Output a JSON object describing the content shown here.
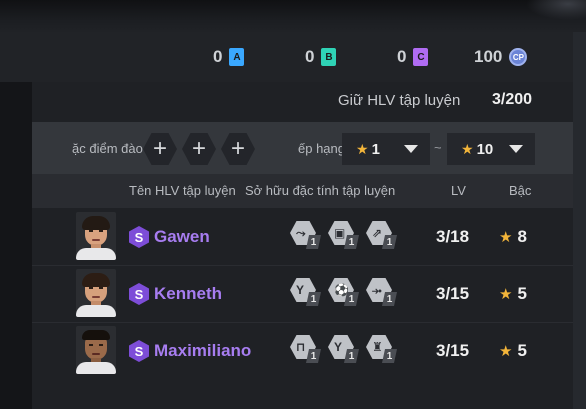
{
  "currencies": [
    {
      "amount": "0",
      "badge": "A",
      "color": "#3aa8ff"
    },
    {
      "amount": "0",
      "badge": "B",
      "color": "#2fd3b6"
    },
    {
      "amount": "0",
      "badge": "C",
      "color": "#b06cf3"
    },
    {
      "amount": "100",
      "badge": "CP",
      "color": "#6b84d6"
    }
  ],
  "hold": {
    "label": "Giữ HLV tập luyện",
    "count": "3/200"
  },
  "filters": {
    "trait_label": "ặc điểm đào",
    "rank_label": "ếp hạng",
    "rank_min": "1",
    "rank_max": "10",
    "tilde": "~"
  },
  "table": {
    "headers": {
      "name": "Tên HLV tập luyện",
      "traits": "Sở hữu đặc tính tập luyện",
      "lv": "LV",
      "rank": "Bậc"
    },
    "rows": [
      {
        "grade": "S",
        "name": "Gawen",
        "traits": [
          {
            "icon": "pass-drill-icon",
            "level": "1"
          },
          {
            "icon": "goalkeeper-drill-icon",
            "level": "1"
          },
          {
            "icon": "sprint-drill-icon",
            "level": "1"
          }
        ],
        "lv": "3/18",
        "rank": "8"
      },
      {
        "grade": "S",
        "name": "Kenneth",
        "traits": [
          {
            "icon": "celebration-drill-icon",
            "level": "1"
          },
          {
            "icon": "dribble-drill-icon",
            "level": "1"
          },
          {
            "icon": "tackle-drill-icon",
            "level": "1"
          }
        ],
        "lv": "3/15",
        "rank": "5"
      },
      {
        "grade": "S",
        "name": "Maximiliano",
        "traits": [
          {
            "icon": "goal-drill-icon",
            "level": "1"
          },
          {
            "icon": "celebration-drill-icon",
            "level": "1"
          },
          {
            "icon": "strength-drill-icon",
            "level": "1"
          }
        ],
        "lv": "3/15",
        "rank": "5"
      }
    ]
  }
}
